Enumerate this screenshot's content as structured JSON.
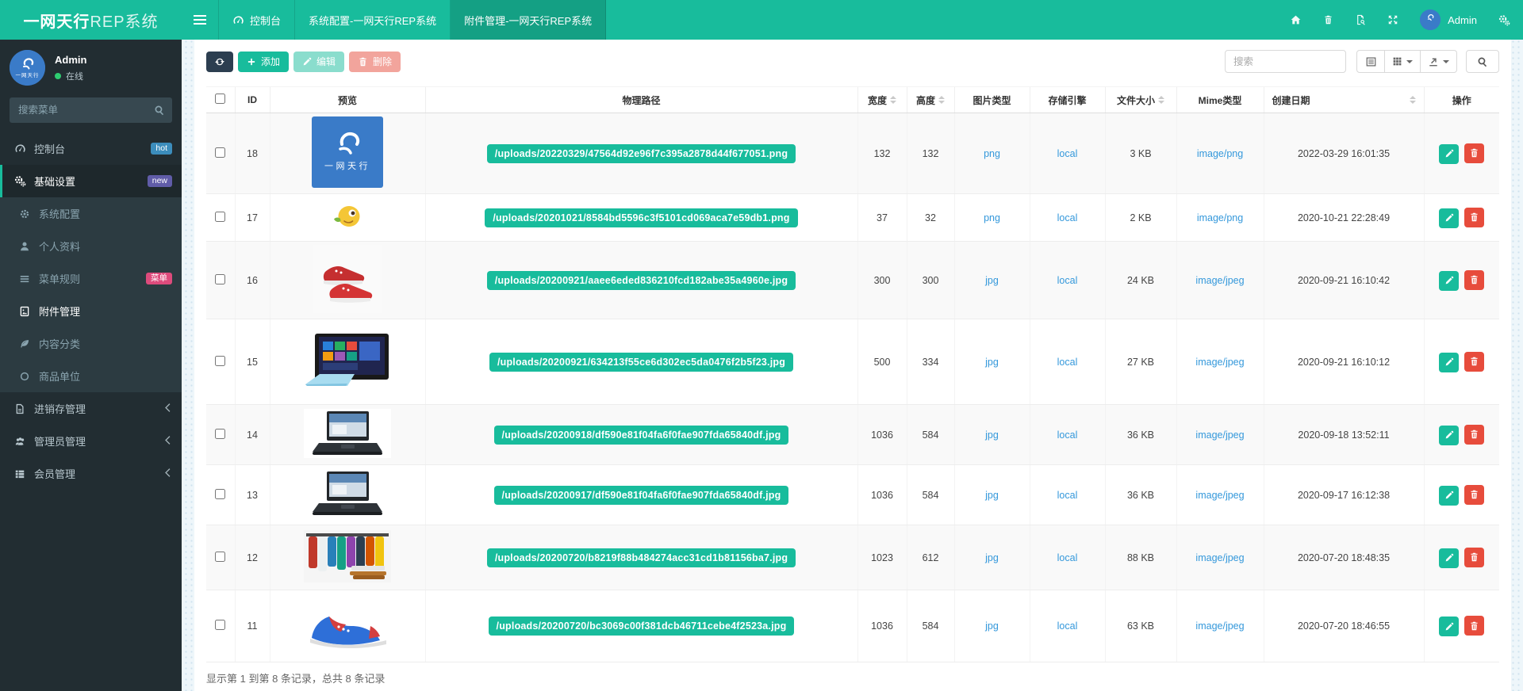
{
  "app": {
    "brand_bold": "一网天行",
    "brand_light": "REP系统"
  },
  "topbar": {
    "tabs": [
      {
        "label": "控制台",
        "icon": "gauge",
        "active": false
      },
      {
        "label": "系统配置-一网天行REP系统",
        "active": false
      },
      {
        "label": "附件管理-一网天行REP系统",
        "active": true
      }
    ],
    "action_icons": [
      "home",
      "trash",
      "file-search",
      "fullscreen"
    ],
    "user_name": "Admin",
    "settings_icon": "gears"
  },
  "sidebar": {
    "user": {
      "name": "Admin",
      "status_label": "在线",
      "status_color": "#2ecc71"
    },
    "search_placeholder": "搜索菜单",
    "menu": [
      {
        "label": "控制台",
        "icon": "gauge",
        "badge": "hot",
        "badge_color": "#3c8dbc"
      },
      {
        "label": "基础设置",
        "icon": "gears",
        "badge": "new",
        "badge_color": "#605ca8",
        "active": true,
        "children": [
          {
            "label": "系统配置",
            "icon": "gear"
          },
          {
            "label": "个人资料",
            "icon": "user"
          },
          {
            "label": "菜单规则",
            "icon": "bars",
            "badge": "菜单",
            "badge_color": "#dd4b7c"
          },
          {
            "label": "附件管理",
            "icon": "image-file",
            "active": true
          },
          {
            "label": "内容分类",
            "icon": "leaf"
          },
          {
            "label": "商品单位",
            "icon": "circle"
          }
        ]
      },
      {
        "label": "进销存管理",
        "icon": "document",
        "collapsible": true
      },
      {
        "label": "管理员管理",
        "icon": "users",
        "collapsible": true
      },
      {
        "label": "会员管理",
        "icon": "list",
        "collapsible": true
      }
    ]
  },
  "toolbar": {
    "add_label": "添加",
    "edit_label": "编辑",
    "delete_label": "删除",
    "search_placeholder": "搜索"
  },
  "table": {
    "columns": [
      {
        "type": "checkbox"
      },
      {
        "label": "ID"
      },
      {
        "label": "预览"
      },
      {
        "label": "物理路径"
      },
      {
        "label": "宽度",
        "sortable": true
      },
      {
        "label": "高度",
        "sortable": true
      },
      {
        "label": "图片类型"
      },
      {
        "label": "存储引擎"
      },
      {
        "label": "文件大小",
        "sortable": true
      },
      {
        "label": "Mime类型"
      },
      {
        "label": "创建日期",
        "sortable": true,
        "sorter_right": true
      },
      {
        "label": "操作"
      }
    ],
    "rows": [
      {
        "id": "18",
        "thumb": "brand-logo",
        "path": "/uploads/20220329/47564d92e96f7c395a2878d44f677051.png",
        "width": "132",
        "height": "132",
        "type": "png",
        "engine": "local",
        "size": "3 KB",
        "mime": "image/png",
        "date": "2022-03-29 16:01:35"
      },
      {
        "id": "17",
        "thumb": "emoji-sticker",
        "path": "/uploads/20201021/8584bd5596c3f5101cd069aca7e59db1.png",
        "width": "37",
        "height": "32",
        "type": "png",
        "engine": "local",
        "size": "2 KB",
        "mime": "image/png",
        "date": "2020-10-21 22:28:49"
      },
      {
        "id": "16",
        "thumb": "red-sneakers",
        "path": "/uploads/20200921/aaee6eded836210fcd182abe35a4960e.jpg",
        "width": "300",
        "height": "300",
        "type": "jpg",
        "engine": "local",
        "size": "24 KB",
        "mime": "image/jpeg",
        "date": "2020-09-21 16:10:42"
      },
      {
        "id": "15",
        "thumb": "tablet",
        "path": "/uploads/20200921/634213f55ce6d302ec5da0476f2b5f23.jpg",
        "width": "500",
        "height": "334",
        "type": "jpg",
        "engine": "local",
        "size": "27 KB",
        "mime": "image/jpeg",
        "date": "2020-09-21 16:10:12"
      },
      {
        "id": "14",
        "thumb": "laptop",
        "path": "/uploads/20200918/df590e81f04fa6f0fae907fda65840df.jpg",
        "width": "1036",
        "height": "584",
        "type": "jpg",
        "engine": "local",
        "size": "36 KB",
        "mime": "image/jpeg",
        "date": "2020-09-18 13:52:11"
      },
      {
        "id": "13",
        "thumb": "laptop",
        "path": "/uploads/20200917/df590e81f04fa6f0fae907fda65840df.jpg",
        "width": "1036",
        "height": "584",
        "type": "jpg",
        "engine": "local",
        "size": "36 KB",
        "mime": "image/jpeg",
        "date": "2020-09-17 16:12:38"
      },
      {
        "id": "12",
        "thumb": "clothes-rack",
        "path": "/uploads/20200720/b8219f88b484274acc31cd1b81156ba7.jpg",
        "width": "1023",
        "height": "612",
        "type": "jpg",
        "engine": "local",
        "size": "88 KB",
        "mime": "image/jpeg",
        "date": "2020-07-20 18:48:35"
      },
      {
        "id": "11",
        "thumb": "blue-sneaker",
        "path": "/uploads/20200720/bc3069c00f381dcb46711cebe4f2523a.jpg",
        "width": "1036",
        "height": "584",
        "type": "jpg",
        "engine": "local",
        "size": "63 KB",
        "mime": "image/jpeg",
        "date": "2020-07-20 18:46:55"
      }
    ]
  },
  "footer": {
    "summary": "显示第 1 到第 8 条记录，总共 8 条记录"
  },
  "colors": {
    "topbar": "#18bc9c",
    "sidebar": "#222d32",
    "accent": "#18bc9c",
    "dark": "#2c3e50",
    "danger": "#e74c3c",
    "link": "#3498db",
    "path_badge": "#18bc9c"
  }
}
